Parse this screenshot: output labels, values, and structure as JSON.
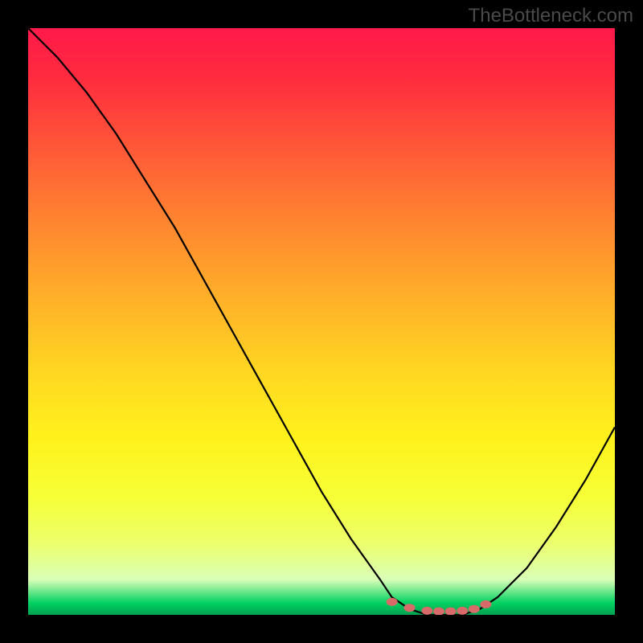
{
  "watermark": "TheBottleneck.com",
  "chart_data": {
    "type": "line",
    "title": "",
    "xlabel": "",
    "ylabel": "",
    "xlim": [
      0,
      100
    ],
    "ylim": [
      0,
      100
    ],
    "series": [
      {
        "name": "curve",
        "x": [
          0,
          5,
          10,
          15,
          20,
          25,
          30,
          35,
          40,
          45,
          50,
          55,
          60,
          62,
          65,
          68,
          71,
          74,
          77,
          80,
          85,
          90,
          95,
          100
        ],
        "values": [
          100,
          95,
          89,
          82,
          74,
          66,
          57,
          48,
          39,
          30,
          21,
          13,
          6,
          3,
          1,
          0,
          0,
          0,
          1,
          3,
          8,
          15,
          23,
          32
        ]
      }
    ],
    "markers": {
      "name": "bottom-dots",
      "x": [
        62,
        65,
        68,
        70,
        72,
        74,
        76,
        78
      ],
      "values": [
        2.2,
        1.2,
        0.7,
        0.6,
        0.6,
        0.7,
        1.0,
        1.8
      ],
      "color": "#d96a6a"
    },
    "colors": {
      "background_gradient": [
        "#ff1a4a",
        "#ff5638",
        "#ffb029",
        "#fff21c",
        "#ecff6e",
        "#00d060"
      ],
      "curve": "#000000",
      "marker": "#d96a6a",
      "frame": "#000000"
    }
  }
}
